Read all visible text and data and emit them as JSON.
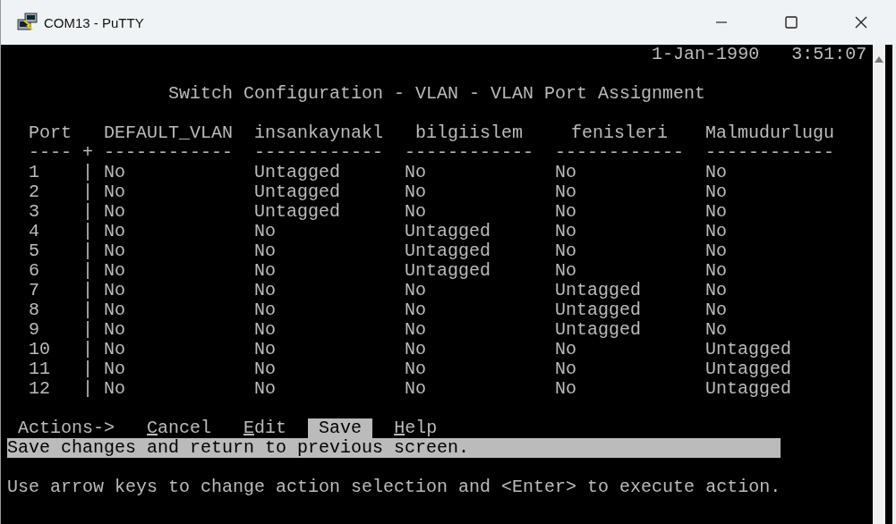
{
  "window": {
    "title": "COM13 - PuTTY"
  },
  "terminal": {
    "date": "1-Jan-1990",
    "time": "3:51:07",
    "heading": "Switch Configuration - VLAN - VLAN Port Assignment",
    "table": {
      "port_header": "Port",
      "columns": [
        "DEFAULT_VLAN",
        "insankaynakl",
        "bilgiislem",
        "fenisleri",
        "Malmudurlugu"
      ],
      "rule": {
        "port": "----",
        "junction": "+",
        "columns": [
          "------------",
          "------------",
          "------------",
          "------------",
          "------------"
        ]
      },
      "rows": [
        {
          "port": "1",
          "sep": "|",
          "values": [
            "No",
            "Untagged",
            "No",
            "No",
            "No"
          ]
        },
        {
          "port": "2",
          "sep": "|",
          "values": [
            "No",
            "Untagged",
            "No",
            "No",
            "No"
          ]
        },
        {
          "port": "3",
          "sep": "|",
          "values": [
            "No",
            "Untagged",
            "No",
            "No",
            "No"
          ]
        },
        {
          "port": "4",
          "sep": "|",
          "values": [
            "No",
            "No",
            "Untagged",
            "No",
            "No"
          ]
        },
        {
          "port": "5",
          "sep": "|",
          "values": [
            "No",
            "No",
            "Untagged",
            "No",
            "No"
          ]
        },
        {
          "port": "6",
          "sep": "|",
          "values": [
            "No",
            "No",
            "Untagged",
            "No",
            "No"
          ]
        },
        {
          "port": "7",
          "sep": "|",
          "values": [
            "No",
            "No",
            "No",
            "Untagged",
            "No"
          ]
        },
        {
          "port": "8",
          "sep": "|",
          "values": [
            "No",
            "No",
            "No",
            "Untagged",
            "No"
          ]
        },
        {
          "port": "9",
          "sep": "|",
          "values": [
            "No",
            "No",
            "No",
            "Untagged",
            "No"
          ]
        },
        {
          "port": "10",
          "sep": "|",
          "values": [
            "No",
            "No",
            "No",
            "No",
            "Untagged"
          ]
        },
        {
          "port": "11",
          "sep": "|",
          "values": [
            "No",
            "No",
            "No",
            "No",
            "Untagged"
          ]
        },
        {
          "port": "12",
          "sep": "|",
          "values": [
            "No",
            "No",
            "No",
            "No",
            "Untagged"
          ]
        }
      ]
    },
    "actions_label": "Actions->",
    "actions": [
      {
        "label": "Cancel",
        "selected": false
      },
      {
        "label": "Edit",
        "selected": false
      },
      {
        "label": "Save",
        "selected": true
      },
      {
        "label": "Help",
        "selected": false
      }
    ],
    "description": "Save changes and return to previous screen.",
    "hint": "Use arrow keys to change action selection and <Enter> to execute action."
  }
}
